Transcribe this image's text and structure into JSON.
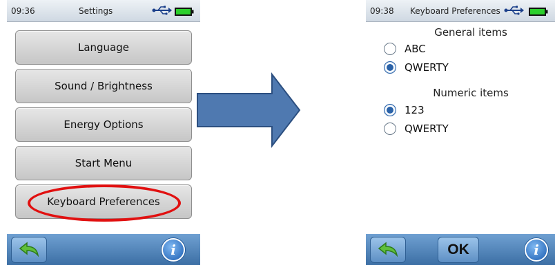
{
  "left_screen": {
    "status": {
      "time": "09:36",
      "title": "Settings"
    },
    "menu_items": [
      {
        "label": "Language"
      },
      {
        "label": "Sound / Brightness"
      },
      {
        "label": "Energy Options"
      },
      {
        "label": "Start Menu"
      },
      {
        "label": "Keyboard Preferences",
        "highlighted": true
      }
    ],
    "toolbar": {
      "back_icon": "back-arrow-icon",
      "info_label": "i"
    }
  },
  "right_screen": {
    "status": {
      "time": "09:38",
      "title": "Keyboard Preferences"
    },
    "general": {
      "heading": "General items",
      "options": [
        {
          "label": "ABC",
          "selected": false
        },
        {
          "label": "QWERTY",
          "selected": true
        }
      ]
    },
    "numeric": {
      "heading": "Numeric items",
      "options": [
        {
          "label": "123",
          "selected": true
        },
        {
          "label": "QWERTY",
          "selected": false
        }
      ]
    },
    "toolbar": {
      "back_icon": "back-arrow-icon",
      "ok_label": "OK",
      "info_label": "i"
    }
  },
  "colors": {
    "highlight": "#e11010",
    "arrow": "#4f79b0",
    "toolbar": "#3c6fa5",
    "radio_selected": "#2a62a8"
  }
}
